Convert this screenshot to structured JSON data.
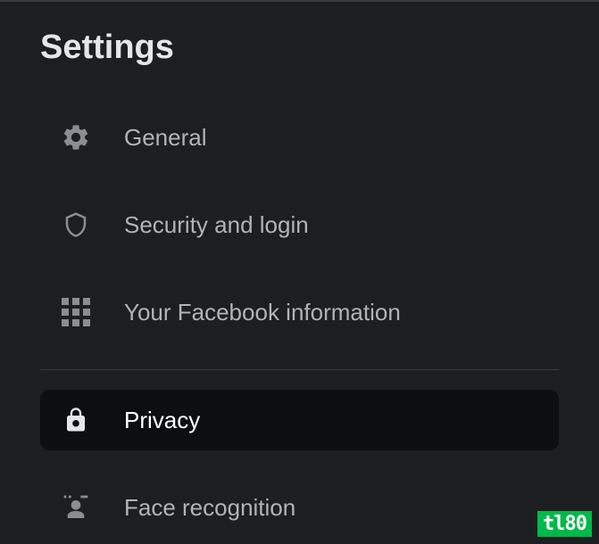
{
  "page": {
    "title": "Settings"
  },
  "menu": {
    "items": [
      {
        "label": "General"
      },
      {
        "label": "Security and login"
      },
      {
        "label": "Your Facebook information"
      },
      {
        "label": "Privacy"
      },
      {
        "label": "Face recognition"
      }
    ]
  },
  "watermark": {
    "text": "tl80"
  }
}
